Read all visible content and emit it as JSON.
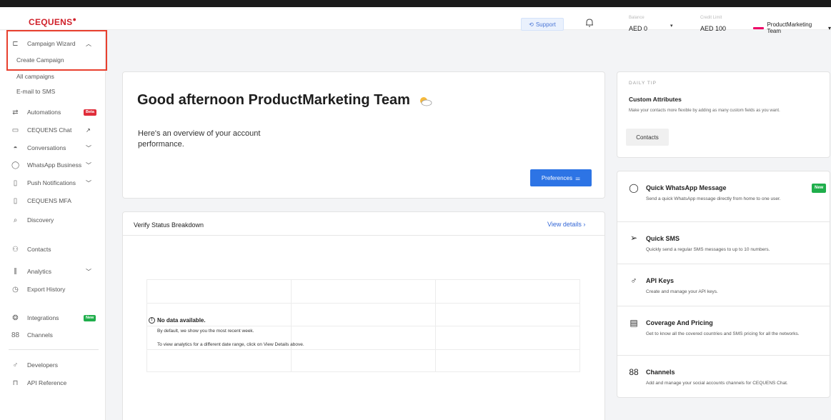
{
  "header": {
    "brand": "CEQUENS",
    "support_label": "Support",
    "balance1_label": "Balance",
    "balance1_value": "AED 0",
    "balance2_label": "Credit Limit",
    "balance2_value": "AED 100",
    "account_name": "ProductMarketing Team"
  },
  "sidebar": {
    "campaign_wizard": "Campaign Wizard",
    "create_campaign": "Create Campaign",
    "all_campaigns": "All campaigns",
    "email_to_sms": "E-mail to SMS",
    "automations": "Automations",
    "automations_badge": "Beta",
    "chat": "CEQUENS Chat",
    "conversations": "Conversations",
    "whatsapp": "WhatsApp Business",
    "push": "Push Notifications",
    "mfa": "CEQUENS MFA",
    "discovery": "Discovery",
    "contacts": "Contacts",
    "analytics": "Analytics",
    "export_history": "Export History",
    "integrations": "Integrations",
    "integrations_badge": "New",
    "channels": "Channels",
    "developers": "Developers",
    "api_reference": "API Reference"
  },
  "welcome": {
    "greeting": "Good afternoon ProductMarketing Team",
    "overview": "Here's an overview of your account performance.",
    "preferences_label": "Preferences"
  },
  "verify": {
    "title": "Verify Status Breakdown",
    "view_details": "View details",
    "no_data": "No data available.",
    "line1": "By default, we show you the most recent week.",
    "line2": "To view analytics for a different date range, click on View Details above."
  },
  "tip": {
    "heading": "DAILY TIP",
    "title": "Custom Attributes",
    "desc": "Make your contacts more flexible by adding as many custom fields as you want.",
    "button": "Contacts"
  },
  "quick_actions": [
    {
      "title": "Quick WhatsApp Message",
      "desc": "Send a quick WhatsApp message directly from home to one user.",
      "badge": "New"
    },
    {
      "title": "Quick SMS",
      "desc": "Quickly send a regular SMS messages to up to 10 numbers."
    },
    {
      "title": "API Keys",
      "desc": "Create and manage your API keys."
    },
    {
      "title": "Coverage And Pricing",
      "desc": "Get to know all the covered countries and SMS pricing for all the networks."
    },
    {
      "title": "Channels",
      "desc": "Add and manage your social accounts channels for CEQUENS Chat."
    }
  ],
  "colors": {
    "brand_red": "#d0202a",
    "primary_blue": "#2d74e5",
    "highlight": "#e8402e",
    "new_green": "#1fae4b"
  }
}
